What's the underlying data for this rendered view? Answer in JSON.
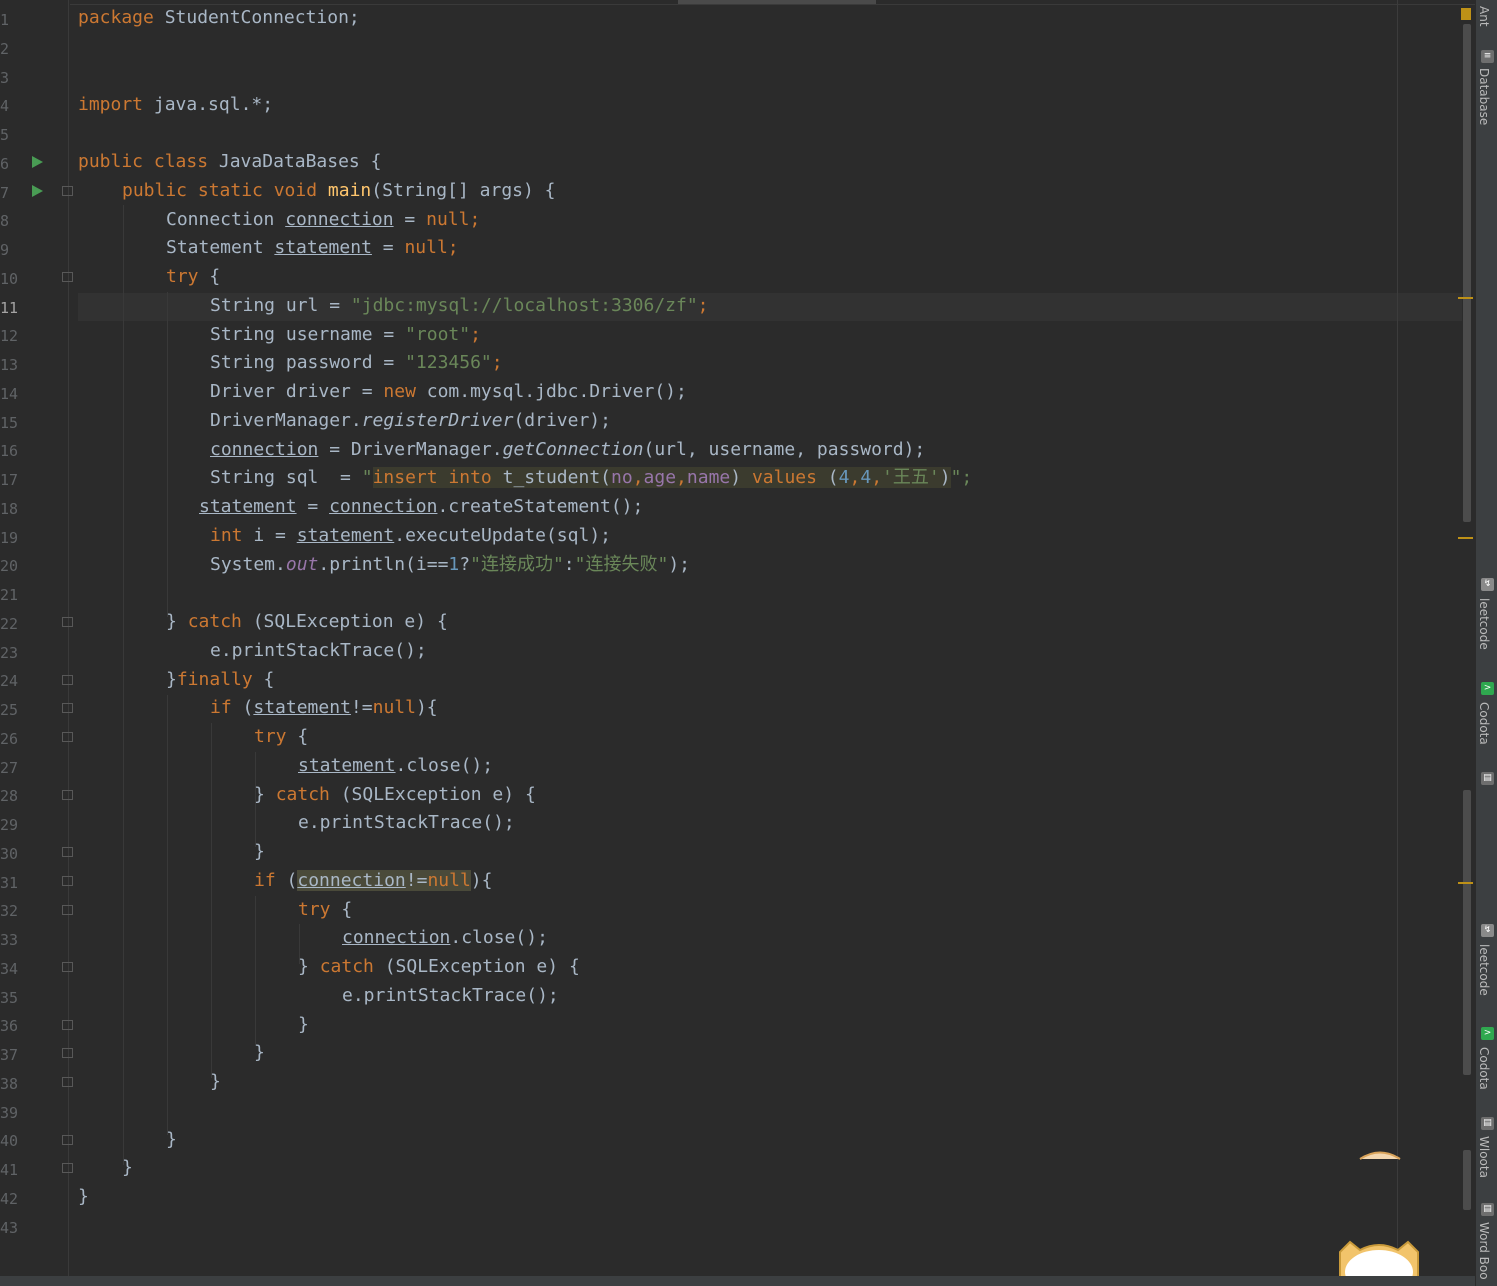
{
  "editor": {
    "line_numbers": [
      "1",
      "2",
      "3",
      "4",
      "5",
      "6",
      "7",
      "8",
      "9",
      "10",
      "11",
      "12",
      "13",
      "14",
      "15",
      "16",
      "17",
      "18",
      "19",
      "20",
      "21",
      "22",
      "23",
      "24",
      "25",
      "26",
      "27",
      "28",
      "29",
      "30",
      "31",
      "32",
      "33",
      "34",
      "35",
      "36",
      "37",
      "38",
      "39",
      "40",
      "41",
      "42",
      "43"
    ],
    "active_line": "11",
    "code": {
      "l1_kw": "package",
      "l1_rest": " StudentConnection;",
      "l4_kw": "import",
      "l4_rest": " java.sql.*;",
      "l6_kw": "public class",
      "l6_rest": " JavaDataBases {",
      "l7_kw": "public static void",
      "l7_fn": "main",
      "l7_rest": "(String[] args) {",
      "l8_a": "Connection ",
      "l8_var": "connection",
      "l8_b": " = ",
      "l8_null": "null;",
      "l9_a": "Statement ",
      "l9_var": "statement",
      "l9_b": " = ",
      "l9_null": "null;",
      "l10_kw": "try",
      "l10_rest": " {",
      "l11_a": "String url = ",
      "l11_str": "\"jdbc:mysql://localhost:3306/zf\"",
      "l11_semi": ";",
      "l12_a": "String username = ",
      "l12_str": "\"root\"",
      "l12_semi": ";",
      "l13_a": "String password = ",
      "l13_str": "\"123456\"",
      "l13_semi": ";",
      "l14_a": "Driver driver = ",
      "l14_kw": "new",
      "l14_rest": " com.mysql.jdbc.Driver();",
      "l15_a": "DriverManager.",
      "l15_it": "registerDriver",
      "l15_rest": "(driver);",
      "l16_var": "connection",
      "l16_a": " = DriverManager.",
      "l16_it": "getConnection",
      "l16_rest": "(url, username, password);",
      "l17_a": "String sql  = ",
      "l17_q1": "\"",
      "l17_sql_kw": "insert into",
      "l17_sql_tbl": " t_student(",
      "l17_c1": "no",
      "l17_c2": "age",
      "l17_c3": "name",
      "l17_sql_close": ") ",
      "l17_values": "values",
      "l17_paren": " (",
      "l17_n1": "4",
      "l17_n2": "4",
      "l17_cn": "'王五'",
      "l17_end": ")",
      "l17_q2": "\";",
      "l18_var": "statement",
      "l18_a": " = ",
      "l18_var2": "connection",
      "l18_rest": ".createStatement();",
      "l19_kw": "int",
      "l19_a": " i = ",
      "l19_var": "statement",
      "l19_rest": ".executeUpdate(sql);",
      "l20_a": "System.",
      "l20_out": "out",
      "l20_b": ".println(i==",
      "l20_num": "1",
      "l20_c": "?",
      "l20_s1": "\"连接成功\"",
      "l20_d": ":",
      "l20_s2": "\"连接失败\"",
      "l20_e": ");",
      "l22_a": "} ",
      "l22_kw": "catch",
      "l22_rest": " (SQLException e) {",
      "l23_a": "e.printStackTrace();",
      "l24_a": "}",
      "l24_kw": "finally",
      "l24_rest": " {",
      "l25_kw": "if",
      "l25_a": " (",
      "l25_var": "statement",
      "l25_b": "!=",
      "l25_null": "null",
      "l25_c": "){",
      "l26_kw": "try",
      "l26_rest": " {",
      "l27_var": "statement",
      "l27_rest": ".close();",
      "l28_a": "} ",
      "l28_kw": "catch",
      "l28_rest": " (SQLException e) {",
      "l29_a": "e.printStackTrace();",
      "l30_a": "}",
      "l31_kw": "if",
      "l31_a": " (",
      "l31_var": "connection",
      "l31_b": "!=",
      "l31_null": "null",
      "l31_c": "){",
      "l32_kw": "try",
      "l32_rest": " {",
      "l33_var": "connection",
      "l33_rest": ".close();",
      "l34_a": "} ",
      "l34_kw": "catch",
      "l34_rest": " (SQLException e) {",
      "l35_a": "e.printStackTrace();",
      "l36_a": "}",
      "l37_a": "}",
      "l38_a": "}",
      "l40_a": "}",
      "l41_a": "}",
      "l42_a": "}"
    }
  },
  "toolwindows": {
    "ant": "Ant",
    "database": "Database",
    "leetcode1": "leetcode",
    "codota1": "Codota",
    "leetcode2": "leetcode",
    "codota2": "Codota",
    "wloota": "Wloota",
    "wordbook": "Word Boo"
  },
  "colors": {
    "background": "#2b2b2b",
    "keyword": "#cc7832",
    "string": "#6a8759",
    "number": "#6897bb",
    "function": "#ffc66d",
    "field": "#9876aa",
    "text": "#a9b7c6",
    "warning": "#be9117",
    "run_icon": "#499c54"
  },
  "icons": {
    "run": "run-gutter-icon",
    "fold": "fold-marker-icon",
    "database": "database-icon",
    "leetcode": "leetcode-icon",
    "codota": "codota-icon",
    "wordbook": "book-icon",
    "mascot": "cat-mascot-icon"
  }
}
